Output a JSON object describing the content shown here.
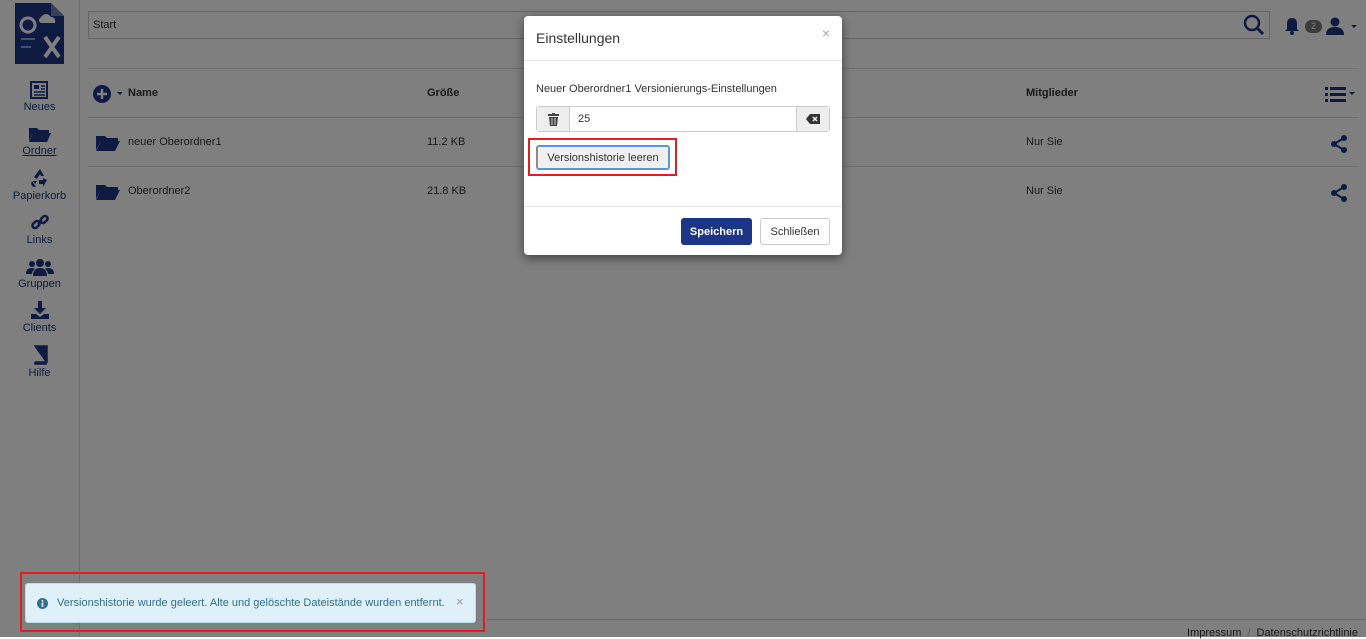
{
  "sidebar": {
    "items": [
      {
        "label": "Neues",
        "icon": "newspaper-icon"
      },
      {
        "label": "Ordner",
        "icon": "folder-open-icon"
      },
      {
        "label": "Papierkorb",
        "icon": "recycle-icon"
      },
      {
        "label": "Links",
        "icon": "link-icon"
      },
      {
        "label": "Gruppen",
        "icon": "users-icon"
      },
      {
        "label": "Clients",
        "icon": "download-icon"
      },
      {
        "label": "Hilfe",
        "icon": "book-icon"
      }
    ],
    "active": "Ordner"
  },
  "topbar": {
    "breadcrumb": "Start",
    "notification_count": "2"
  },
  "table": {
    "headers": {
      "name": "Name",
      "size": "Größe",
      "members": "Mitglieder"
    },
    "rows": [
      {
        "name": "neuer Oberordner1",
        "size": "11.2 KB",
        "members": "Nur Sie"
      },
      {
        "name": "Oberordner2",
        "size": "21.8 KB",
        "members": "Nur Sie"
      }
    ]
  },
  "modal": {
    "title": "Einstellungen",
    "close_glyph": "×",
    "label": "Neuer Oberordner1 Versionierungs-Einstellungen",
    "input_value": "25",
    "clear_history_label": "Versionshistorie leeren",
    "save_label": "Speichern",
    "close_label": "Schließen"
  },
  "toast": {
    "message": "Versionshistorie wurde geleert. Alte und gelöschte Dateistände wurden entfernt.",
    "close_glyph": "×"
  },
  "footer": {
    "impressum": "Impressum",
    "privacy": "Datenschutzrichtlinie"
  },
  "colors": {
    "brand_navy": "#1c3585",
    "highlight_red": "#e02020",
    "info_bg": "#dff0f8"
  }
}
